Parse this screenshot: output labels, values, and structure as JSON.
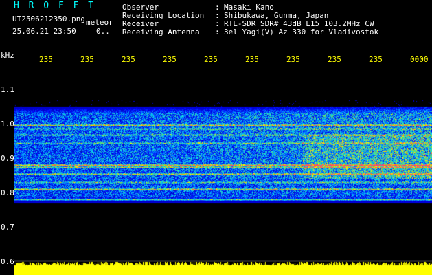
{
  "app": {
    "name": "H R O F F T",
    "file_name": "UT2506212350.png",
    "file_suffix": "meteor",
    "date_time": "25.06.21 23:50",
    "extra": "0.."
  },
  "info": [
    {
      "label": "Observer",
      "sep": ":",
      "value": "Masaki Kano"
    },
    {
      "label": "Receiving Location",
      "sep": ":",
      "value": "Shibukawa, Gunma, Japan"
    },
    {
      "label": "Receiver",
      "sep": ":",
      "value": "RTL-SDR SDR# 43dB L15 103.2MHz CW"
    },
    {
      "label": "Receiving Antenna",
      "sep": ":",
      "value": "3el Yagi(V) Az 330 for Vladivostok"
    }
  ],
  "y_axis": {
    "unit": "kHz",
    "ticks": [
      "1.1",
      "1.0",
      "0.9",
      "0.8",
      "0.7",
      "0.6"
    ]
  },
  "x_axis": {
    "ticks": [
      "235",
      "235",
      "235",
      "235",
      "235",
      "235",
      "235",
      "235",
      "235",
      "0000"
    ]
  },
  "colors": {
    "header_cyan": "#00ffff",
    "header_text": "#ffffff",
    "tick_yellow": "#ffff00",
    "amplitude_yellow": "#ffff00"
  }
}
